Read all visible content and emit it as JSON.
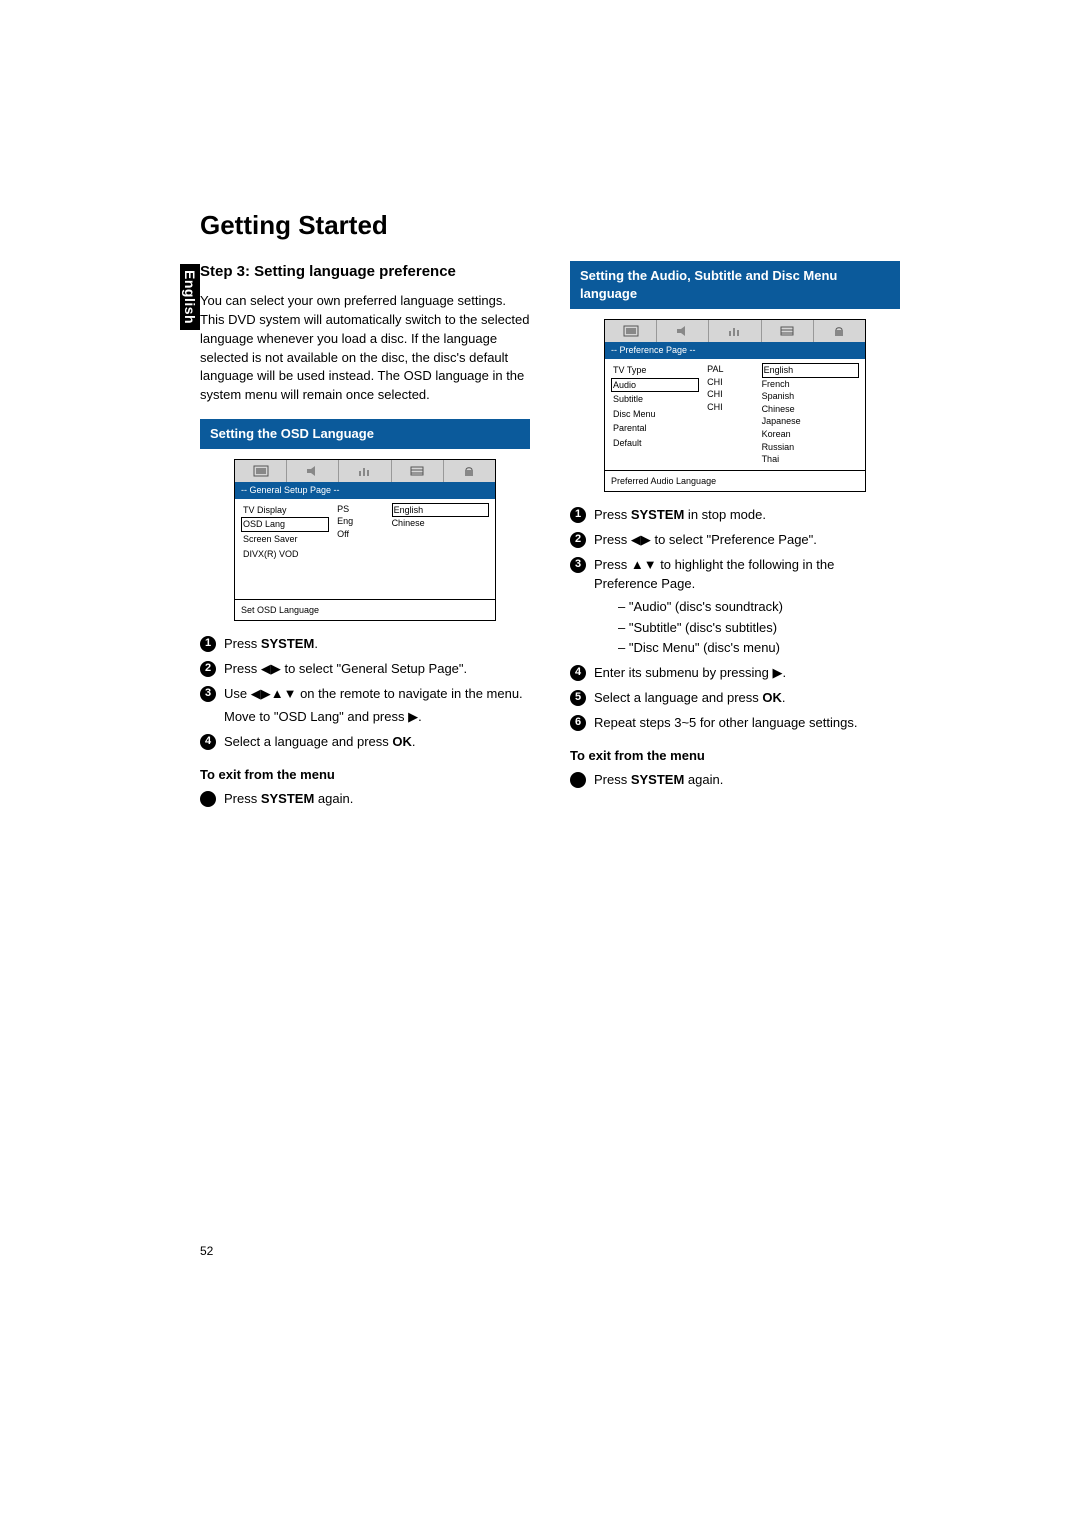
{
  "sideTab": "English",
  "title": "Getting Started",
  "pageNumber": "52",
  "left": {
    "stepHeading": "Step 3:  Setting language preference",
    "intro": "You can select your own preferred language settings. This DVD system will automatically switch to the selected language whenever you load a disc. If the language selected is not available on the disc, the disc's default language will be used instead. The OSD language in the system menu will remain once selected.",
    "banner": "Setting the OSD Language",
    "osd": {
      "pageLabel": "-- General Setup Page --",
      "menuItems": [
        "TV Display",
        "OSD Lang",
        "Screen Saver",
        "DIVX(R) VOD"
      ],
      "selectedMenuIndex": 1,
      "values": [
        "PS",
        "Eng",
        "Off",
        ""
      ],
      "options": [
        "English",
        "Chinese"
      ],
      "selectedOptionIndex": 0,
      "footer": "Set OSD Language"
    },
    "steps": [
      {
        "n": "1",
        "html": "Press <b>SYSTEM</b>."
      },
      {
        "n": "2",
        "html": "Press <span class='arrow'>◀▶</span> to select \"General Setup Page\"."
      },
      {
        "n": "3",
        "html": "Use <span class='arrow'>◀▶▲▼</span> on the remote to navigate in the menu.",
        "cont": "Move to \"OSD Lang\" and press <span class='arrow'>▶</span>."
      },
      {
        "n": "4",
        "html": "Select a language and press <b>OK</b>."
      }
    ],
    "exitHeading": "To exit from the menu",
    "exitStep": "Press <b>SYSTEM</b> again."
  },
  "right": {
    "banner": "Setting the Audio, Subtitle and Disc Menu language",
    "osd": {
      "pageLabel": "-- Preference Page --",
      "menuItems": [
        "TV Type",
        "Audio",
        "Subtitle",
        "Disc Menu",
        "Parental",
        "Default"
      ],
      "selectedMenuIndex": 1,
      "values": [
        "PAL",
        "CHI",
        "CHI",
        "CHI",
        "",
        ""
      ],
      "options": [
        "English",
        "French",
        "Spanish",
        "Chinese",
        "Japanese",
        "Korean",
        "Russian",
        "Thai"
      ],
      "selectedOptionIndex": 0,
      "footer": "Preferred Audio Language"
    },
    "steps": [
      {
        "n": "1",
        "html": "Press <b>SYSTEM</b> in stop mode."
      },
      {
        "n": "2",
        "html": "Press <span class='arrow'>◀▶</span> to select \"Preference Page\"."
      },
      {
        "n": "3",
        "html": "Press <span class='arrow'>▲▼</span> to highlight the following in the Preference Page.",
        "dashes": [
          "\"Audio\" (disc's soundtrack)",
          "\"Subtitle\" (disc's subtitles)",
          "\"Disc Menu\" (disc's menu)"
        ]
      },
      {
        "n": "4",
        "html": "Enter its submenu by pressing <span class='arrow'>▶</span>."
      },
      {
        "n": "5",
        "html": "Select a language and press <b>OK</b>."
      },
      {
        "n": "6",
        "html": "Repeat steps 3~5 for other language settings."
      }
    ],
    "exitHeading": "To exit from the menu",
    "exitStep": "Press <b>SYSTEM</b> again."
  }
}
